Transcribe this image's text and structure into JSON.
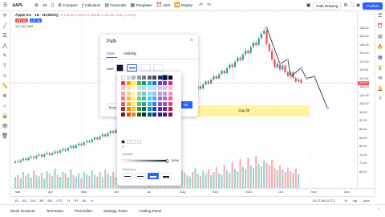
{
  "toolbar": {
    "symbol": "AAPL",
    "items": [
      {
        "icon": "plus-icon",
        "label": ""
      },
      {
        "icon": "interval",
        "label": "1D"
      },
      {
        "icon": "candles-icon",
        "label": ""
      },
      {
        "icon": "compare-icon",
        "label": "Compare"
      },
      {
        "icon": "indicators-icon",
        "label": "Indicators"
      },
      {
        "icon": "financials-icon",
        "label": "Financials"
      },
      {
        "icon": "templates-icon",
        "label": "Templates"
      },
      {
        "icon": "alert-icon",
        "label": "Alert"
      },
      {
        "icon": "replay-icon",
        "label": "Replay"
      }
    ],
    "layout_name": "Path Drawing",
    "publish_label": "Publish"
  },
  "legend": {
    "title": "Apple Inc · 1D · NASDAQ",
    "ohlc": "O 115.38 H 116.49 L 108.00 C 110.00 -3.52 (-3.12%)",
    "sell_price": "107.93",
    "buy_price": "107.94",
    "volume": "Vol 164.38M"
  },
  "price_scale": {
    "ticks": [
      "136.00",
      "132.00",
      "128.00",
      "124.00",
      "120.00",
      "116.00",
      "112.00",
      "108.00",
      "104.00",
      "100.00",
      "96.00",
      "92.00",
      "88.00",
      "84.00",
      "80.00",
      "76.00",
      "72.00",
      "68.00"
    ],
    "current": "109.95"
  },
  "time_axis": {
    "ticks": [
      "Mar",
      "Apr",
      "May",
      "Jun",
      "Jul",
      "Aug",
      "Sep",
      "2020",
      "Oct",
      "Nov",
      "Dec"
    ]
  },
  "range_bar": {
    "ranges": [
      "1D",
      "5D",
      "1M",
      "3M",
      "6M",
      "YTD",
      "1Y",
      "5Y",
      "All"
    ],
    "time": "19:37:58 (UTC)",
    "pct": "%",
    "log": "log",
    "auto": "auto"
  },
  "bottom_tabs": [
    "Stock Screener",
    "Text Notes",
    "Pine Editor",
    "Strategy Tester",
    "Trading Panel"
  ],
  "gap_fill": {
    "label": "Gap fill"
  },
  "path_dialog": {
    "title": "Path",
    "tab_style": "Style",
    "tab_visibility": "Visibility",
    "line_label": "Line",
    "template_label": "Temp",
    "ok_label": "Ok"
  },
  "color_picker": {
    "opacity_label": "Opacity",
    "opacity_value": "100%",
    "thickness_label": "Thickness",
    "palette": [
      [
        "#ffffff",
        "#d1d4dc",
        "#b2b5be",
        "#9598a1",
        "#787b86",
        "#5d606b",
        "#434651",
        "#2a2e39",
        "#131722",
        "#000000"
      ],
      [
        "#f23645",
        "#ff9800",
        "#ffeb3b",
        "#4caf50",
        "#089981",
        "#00bcd4",
        "#2962ff",
        "#673ab7",
        "#9c27b0",
        "#e91e63"
      ],
      [
        "#fccbcd",
        "#ffe0b2",
        "#fff9c4",
        "#c8e6c9",
        "#ace5dc",
        "#b2ebf2",
        "#bbd9fb",
        "#d1c4e9",
        "#e1bee7",
        "#f8bbd0"
      ],
      [
        "#faa1a4",
        "#ffcc80",
        "#fff59d",
        "#a5d6a7",
        "#70ccbd",
        "#80deea",
        "#90bff9",
        "#b39ddb",
        "#ce93d8",
        "#f48fb1"
      ],
      [
        "#f77c80",
        "#ffb74d",
        "#fff176",
        "#81c784",
        "#42bda8",
        "#4dd0e1",
        "#5b9cf6",
        "#9575cd",
        "#ba68c8",
        "#f06292"
      ],
      [
        "#f7525f",
        "#ffa726",
        "#ffee58",
        "#66bb6a",
        "#22ab94",
        "#26c6da",
        "#3179f5",
        "#7e57c2",
        "#ab47bc",
        "#ec407a"
      ],
      [
        "#b22833",
        "#f57c00",
        "#fbc02d",
        "#388e3c",
        "#056656",
        "#0097a7",
        "#1848cc",
        "#512da8",
        "#7b1fa2",
        "#c2185b"
      ],
      [
        "#801922",
        "#e65100",
        "#f57f17",
        "#1b5e20",
        "#00332a",
        "#006064",
        "#0c3299",
        "#311b92",
        "#4a148c",
        "#880e4f"
      ]
    ],
    "custom": [
      "#131722",
      "#ffffff",
      "#ffffff",
      "#ffffff"
    ]
  },
  "chart_data": {
    "type": "candlestick",
    "y_range": [
      66,
      140
    ],
    "candles": [
      [
        72.2,
        72.9,
        73.7,
        71.9
      ],
      [
        72.9,
        72.6,
        73.8,
        72.1
      ],
      [
        72.6,
        73.4,
        74.2,
        71.9
      ],
      [
        73.4,
        74.2,
        75.1,
        72.8
      ],
      [
        74.2,
        73.5,
        75.0,
        72.6
      ],
      [
        73.5,
        74.6,
        75.3,
        72.9
      ],
      [
        74.6,
        75.2,
        76.2,
        74.1
      ],
      [
        75.2,
        74.4,
        75.9,
        73.6
      ],
      [
        74.4,
        75.6,
        76.1,
        73.8
      ],
      [
        75.6,
        76.1,
        77.0,
        75.0
      ],
      [
        76.1,
        75.1,
        76.9,
        74.3
      ],
      [
        75.1,
        76.3,
        77.0,
        74.5
      ],
      [
        76.3,
        76.8,
        77.7,
        75.8
      ],
      [
        76.8,
        75.9,
        77.4,
        75.2
      ],
      [
        75.9,
        76.8,
        77.6,
        75.3
      ],
      [
        76.8,
        77.6,
        78.5,
        76.1
      ],
      [
        77.6,
        76.9,
        78.2,
        76.1
      ],
      [
        76.9,
        78.0,
        78.8,
        76.5
      ],
      [
        78.0,
        78.7,
        79.6,
        77.4
      ],
      [
        78.7,
        78.0,
        79.4,
        77.2
      ],
      [
        78.0,
        79.3,
        80.0,
        77.4
      ],
      [
        79.3,
        80.1,
        81.0,
        78.7
      ],
      [
        80.1,
        79.2,
        80.9,
        78.5
      ],
      [
        79.2,
        80.5,
        81.2,
        78.8
      ],
      [
        80.5,
        81.3,
        82.2,
        79.9
      ],
      [
        81.3,
        80.6,
        82.0,
        79.9
      ],
      [
        80.6,
        81.9,
        82.5,
        80.1
      ],
      [
        81.9,
        82.6,
        83.5,
        81.3
      ],
      [
        82.6,
        82.0,
        83.2,
        81.4
      ],
      [
        82.0,
        83.2,
        83.9,
        81.5
      ],
      [
        83.2,
        84.2,
        85.0,
        82.6
      ],
      [
        84.2,
        83.3,
        84.9,
        82.7
      ],
      [
        83.3,
        84.7,
        85.4,
        82.9
      ],
      [
        84.7,
        85.6,
        86.3,
        84.1
      ],
      [
        85.6,
        84.8,
        86.4,
        84.2
      ],
      [
        84.8,
        86.2,
        86.9,
        84.2
      ],
      [
        86.2,
        87.2,
        88.0,
        85.6
      ],
      [
        87.2,
        86.4,
        87.8,
        85.8
      ],
      [
        86.4,
        87.8,
        88.5,
        85.9
      ],
      [
        87.8,
        88.9,
        89.5,
        87.2
      ],
      [
        88.9,
        88.0,
        89.6,
        87.4
      ],
      [
        88.0,
        89.5,
        90.2,
        87.6
      ],
      [
        89.5,
        90.6,
        91.3,
        89.0
      ],
      [
        90.6,
        89.6,
        91.3,
        89.0
      ],
      [
        89.6,
        91.1,
        91.8,
        89.1
      ],
      [
        91.1,
        92.2,
        93.0,
        90.6
      ],
      [
        92.2,
        91.4,
        92.8,
        90.7
      ],
      [
        91.4,
        93.0,
        93.6,
        90.9
      ],
      [
        93.0,
        94.1,
        94.8,
        92.5
      ],
      [
        94.1,
        93.2,
        94.9,
        92.6
      ],
      [
        93.2,
        94.8,
        95.5,
        92.7
      ],
      [
        94.8,
        96.0,
        96.8,
        94.3
      ],
      [
        96.0,
        95.0,
        96.6,
        94.3
      ],
      [
        95.0,
        96.6,
        97.3,
        94.5
      ],
      [
        96.6,
        97.9,
        98.5,
        96.0
      ],
      [
        97.9,
        96.9,
        98.6,
        96.2
      ],
      [
        96.9,
        98.6,
        99.3,
        96.3
      ],
      [
        98.6,
        99.8,
        100.6,
        98.1
      ],
      [
        99.8,
        98.8,
        100.4,
        98.2
      ],
      [
        98.8,
        100.6,
        101.2,
        98.3
      ],
      [
        100.6,
        101.9,
        102.6,
        100.0
      ],
      [
        101.9,
        100.9,
        102.5,
        100.2
      ],
      [
        100.9,
        102.7,
        103.4,
        100.3
      ],
      [
        102.7,
        104.0,
        104.7,
        102.0
      ],
      [
        104.0,
        102.9,
        104.6,
        102.3
      ],
      [
        102.9,
        104.8,
        105.5,
        102.4
      ],
      [
        104.8,
        106.1,
        106.8,
        104.2
      ],
      [
        106.1,
        105.1,
        106.8,
        104.4
      ],
      [
        105.1,
        107.0,
        107.6,
        104.6
      ],
      [
        107.0,
        108.4,
        109.1,
        106.3
      ],
      [
        108.4,
        107.3,
        109.0,
        106.6
      ],
      [
        107.3,
        109.3,
        110.0,
        106.7
      ],
      [
        109.3,
        110.7,
        111.4,
        108.7
      ],
      [
        110.7,
        109.6,
        111.4,
        108.9
      ],
      [
        109.6,
        111.6,
        112.4,
        109.1
      ],
      [
        111.6,
        113.1,
        114.0,
        111.0
      ],
      [
        113.1,
        112.0,
        113.8,
        111.3
      ],
      [
        112.0,
        114.1,
        115.0,
        111.4
      ],
      [
        114.1,
        115.7,
        116.6,
        113.5
      ],
      [
        115.7,
        114.5,
        116.4,
        113.8
      ],
      [
        114.5,
        116.9,
        117.7,
        114.0
      ],
      [
        116.9,
        118.6,
        119.5,
        116.3
      ],
      [
        118.6,
        117.5,
        119.3,
        116.8
      ],
      [
        117.5,
        120.0,
        120.9,
        117.0
      ],
      [
        120.0,
        121.9,
        122.9,
        119.4
      ],
      [
        121.9,
        120.7,
        122.6,
        119.9
      ],
      [
        120.7,
        123.4,
        124.3,
        120.2
      ],
      [
        123.4,
        125.2,
        126.2,
        122.8
      ],
      [
        125.2,
        124.0,
        125.9,
        123.3
      ],
      [
        124.0,
        127.0,
        128.0,
        123.5
      ],
      [
        127.0,
        129.0,
        130.1,
        126.4
      ],
      [
        129.0,
        127.8,
        129.8,
        127.1
      ],
      [
        127.8,
        131.0,
        132.1,
        127.2
      ],
      [
        131.0,
        133.2,
        134.3,
        130.4
      ],
      [
        133.2,
        134.6,
        136.1,
        132.5
      ],
      [
        134.6,
        128.3,
        135.3,
        127.7
      ],
      [
        128.3,
        125.0,
        129.2,
        124.4
      ],
      [
        125.0,
        121.0,
        126.3,
        120.3
      ],
      [
        121.0,
        117.3,
        122.3,
        116.6
      ],
      [
        117.3,
        119.0,
        120.0,
        116.5
      ],
      [
        119.0,
        116.2,
        119.8,
        115.4
      ],
      [
        116.2,
        118.2,
        119.1,
        115.6
      ],
      [
        118.2,
        115.0,
        118.9,
        114.3
      ],
      [
        115.0,
        113.2,
        115.9,
        112.5
      ],
      [
        113.2,
        114.9,
        115.8,
        112.7
      ],
      [
        114.9,
        112.3,
        115.6,
        111.7
      ],
      [
        112.3,
        110.6,
        113.0,
        110.0
      ],
      [
        110.6,
        111.6,
        112.4,
        109.9
      ],
      [
        111.6,
        110.0,
        112.3,
        109.3
      ]
    ],
    "volumes": [
      0.35,
      0.42,
      0.3,
      0.5,
      0.38,
      0.45,
      0.33,
      0.55,
      0.4,
      0.36,
      0.48,
      0.3,
      0.52,
      0.44,
      0.37,
      0.6,
      0.41,
      0.35,
      0.5,
      0.46,
      0.34,
      0.58,
      0.4,
      0.36,
      0.47,
      0.31,
      0.5,
      0.43,
      0.38,
      0.55,
      0.42,
      0.36,
      0.49,
      0.33,
      0.57,
      0.45,
      0.38,
      0.5,
      0.35,
      0.46,
      0.41,
      0.34,
      0.53,
      0.39,
      0.44,
      0.36,
      0.5,
      0.42,
      0.38,
      0.55,
      0.4,
      0.34,
      0.48,
      0.44,
      0.37,
      0.52,
      0.41,
      0.35,
      0.5,
      0.46,
      0.38,
      0.42,
      0.35,
      0.55,
      0.48,
      0.4,
      0.36,
      0.5,
      0.62,
      0.45,
      0.38,
      0.53,
      0.44,
      0.58,
      0.4,
      0.5,
      0.66,
      0.47,
      0.42,
      0.72,
      0.55,
      0.48,
      0.8,
      0.6,
      0.52,
      0.9,
      0.65,
      0.58,
      0.95,
      0.7,
      0.62,
      1.0,
      0.75,
      0.68,
      0.85,
      0.78,
      0.72,
      0.88,
      0.62,
      0.55,
      0.7,
      0.58,
      0.5,
      0.64,
      0.52,
      0.48,
      0.6,
      0.45
    ],
    "path_line": [
      [
        95,
        136
      ],
      [
        100,
        119
      ],
      [
        103,
        121
      ],
      [
        104,
        113
      ],
      [
        108,
        117
      ],
      [
        110,
        112
      ],
      [
        113,
        113
      ],
      [
        118,
        98
      ]
    ]
  }
}
